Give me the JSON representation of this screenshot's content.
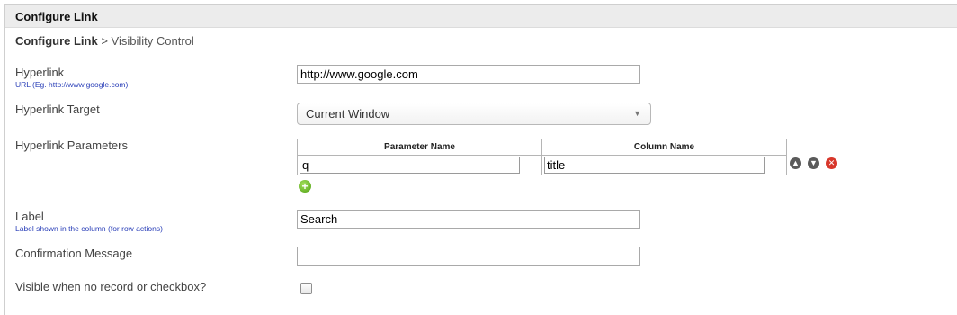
{
  "panel": {
    "title": "Configure Link"
  },
  "breadcrumb": {
    "current": "Configure Link",
    "separator": " > ",
    "next": "Visibility Control"
  },
  "hyperlink": {
    "label": "Hyperlink",
    "hint": "URL (Eg. http://www.google.com)",
    "value": "http://www.google.com"
  },
  "target": {
    "label": "Hyperlink Target",
    "selected": "Current Window",
    "caret_icon": "dropdown-caret"
  },
  "parameters": {
    "label": "Hyperlink Parameters",
    "columns": [
      "Parameter Name",
      "Column Name"
    ],
    "rows": [
      {
        "param": "q",
        "column": "title"
      }
    ],
    "icons": {
      "up": "arrow-up-icon",
      "down": "arrow-down-icon",
      "delete": "delete-icon",
      "add": "add-icon"
    }
  },
  "label_field": {
    "label": "Label",
    "hint": "Label shown in the column (for row actions)",
    "value": "Search"
  },
  "confirmation": {
    "label": "Confirmation Message",
    "value": ""
  },
  "visible": {
    "label": "Visible when no record or checkbox?",
    "checked": false
  },
  "colors": {
    "header_bg": "#ececec",
    "hint_text": "#2a3fb8",
    "delete_icon": "#d8372b",
    "add_icon": "#4e9f12"
  }
}
